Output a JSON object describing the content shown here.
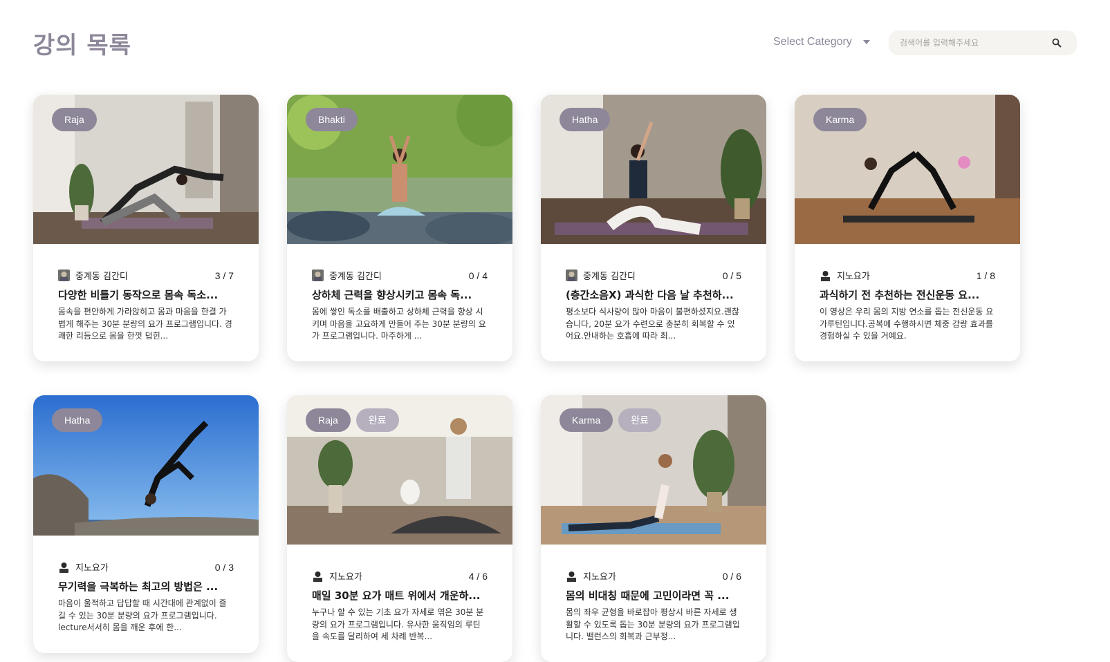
{
  "header": {
    "title": "강의 목록",
    "category_label": "Select Category",
    "search_placeholder": "검색어를 입력해주세요"
  },
  "icons": {
    "search": "search-icon",
    "dropdown": "chevron-down-icon"
  },
  "colors": {
    "accent": "#8d8799",
    "tag_done": "#b5afbe",
    "search_bg": "#f5f4f1"
  },
  "cards": [
    {
      "tags": [
        "Raja"
      ],
      "teacher": "중계동 김간디",
      "progress": "3 / 7",
      "title": "다양한 비틀기 동작으로 몸속 독소...",
      "description": "몸속을 편안하게 가라앉히고 몸과 마음을 한결 가볍게 해주는 30분 분량의 요가 프로그램입니다. 경쾌한 리듬으로 몸을 한껏 덥힌..."
    },
    {
      "tags": [
        "Bhakti"
      ],
      "teacher": "중계동 김간디",
      "progress": "0 / 4",
      "title": "상하체 근력을 향상시키고 몸속 독...",
      "description": "몸에 쌓인 독소를 배출하고 상하체 근력을 향상 시키며 마음을 고요하게 만들어 주는 30분 분량의 요가 프로그램입니다. 마주하게 ..."
    },
    {
      "tags": [
        "Hatha"
      ],
      "teacher": "중계동 김간디",
      "progress": "0 / 5",
      "title": "(층간소음X) 과식한 다음 날 추천하...",
      "description": "평소보다 식사량이 많아 마음이 불편하셨지요.괜찮습니다, 20분 요가 수련으로 충분히 회복할 수 있어요.안내하는 호흡에 따라 최..."
    },
    {
      "tags": [
        "Karma"
      ],
      "teacher": "지노요가",
      "progress": "1 / 8",
      "title": "과식하기 전 추천하는 전신운동 요...",
      "description": "이 영상은 우리 몸의 지방 연소를 돕는 전신운동 요가루틴입니다.공복에 수행하시면 체중 감량 효과를 경험하실 수 있을 거예요."
    },
    {
      "tags": [
        "Hatha"
      ],
      "teacher": "지노요가",
      "progress": "0 / 3",
      "title": "무기력을 극복하는 최고의 방법은 ...",
      "description": "마음이 울적하고 답답할 때 시간대에 관계없이 즐길 수 있는 30분 분량의 요가 프로그램입니다. lecture서서히 몸을 깨운 후에 한..."
    },
    {
      "tags": [
        "Raja",
        "완료"
      ],
      "teacher": "지노요가",
      "progress": "4 / 6",
      "title": "매일 30분 요가 매트 위에서 개운하...",
      "description": "누구나 할 수 있는 기초 요가 자세로 엮은 30분 분량의 요가 프로그램입니다. 유사한 움직임의 루틴을 속도를 달리하여 세 차례 반복..."
    },
    {
      "tags": [
        "Karma",
        "완료"
      ],
      "teacher": "지노요가",
      "progress": "0 / 6",
      "title": "몸의 비대칭 때문에 고민이라면 꼭 ...",
      "description": "몸의 좌우 균형을 바로잡아 평상시 바른 자세로 생활할 수 있도록 돕는 30분 분량의 요가 프로그램입니다. 밸런스의 회복과 근부정..."
    }
  ]
}
